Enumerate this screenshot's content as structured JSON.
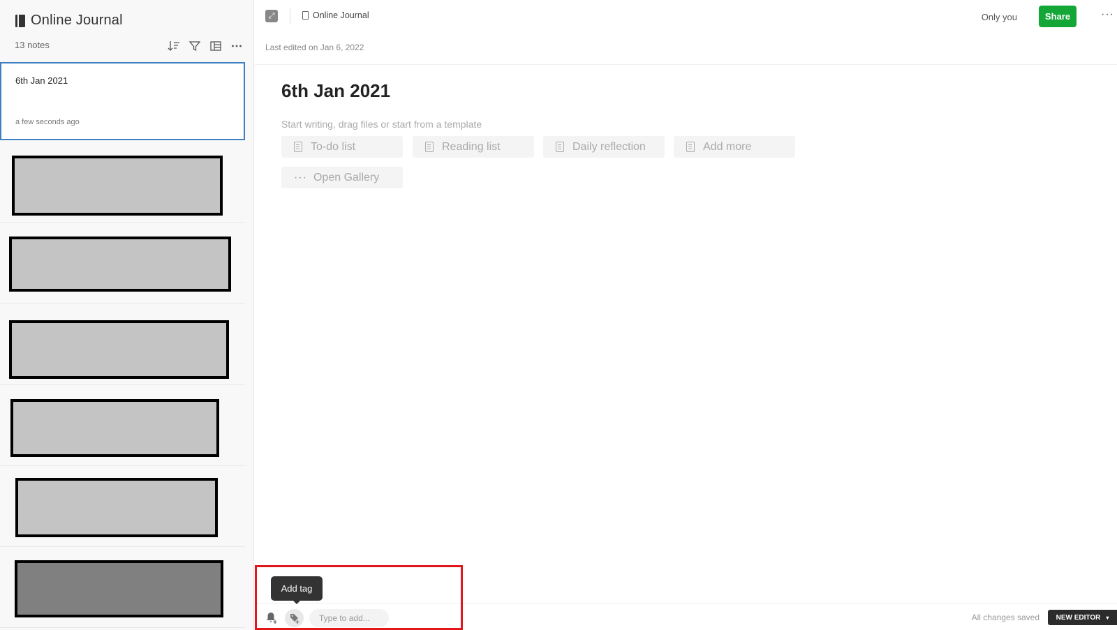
{
  "notebook": {
    "title": "Online Journal",
    "note_count": "13 notes"
  },
  "list_tools": [
    "sort-icon",
    "filter-icon",
    "view-icon",
    "more-icon"
  ],
  "selected_note": {
    "title": "6th Jan 2021",
    "time": "a few seconds ago"
  },
  "topbar": {
    "breadcrumb": "Online Journal",
    "share_scope": "Only you",
    "share_label": "Share",
    "more": "···"
  },
  "editor": {
    "last_edited": "Last edited on Jan 6, 2022",
    "heading": "6th Jan 2021",
    "placeholder": "Start writing, drag files or start from a template",
    "templates": [
      {
        "label": "To-do list",
        "icon": "document-icon"
      },
      {
        "label": "Reading list",
        "icon": "document-icon"
      },
      {
        "label": "Daily reflection",
        "icon": "document-icon"
      },
      {
        "label": "Add more",
        "icon": "add-document-icon"
      },
      {
        "label": "Open Gallery",
        "icon": "dots-icon"
      }
    ]
  },
  "footer": {
    "tooltip": "Add tag",
    "tag_placeholder": "Type to add...",
    "saved_status": "All changes saved",
    "new_editor_label": "NEW EDITOR",
    "caret": "▾"
  },
  "colors": {
    "accent_blue": "#3e7fc1",
    "share_green": "#14a637",
    "highlight_red": "#e3161c"
  }
}
